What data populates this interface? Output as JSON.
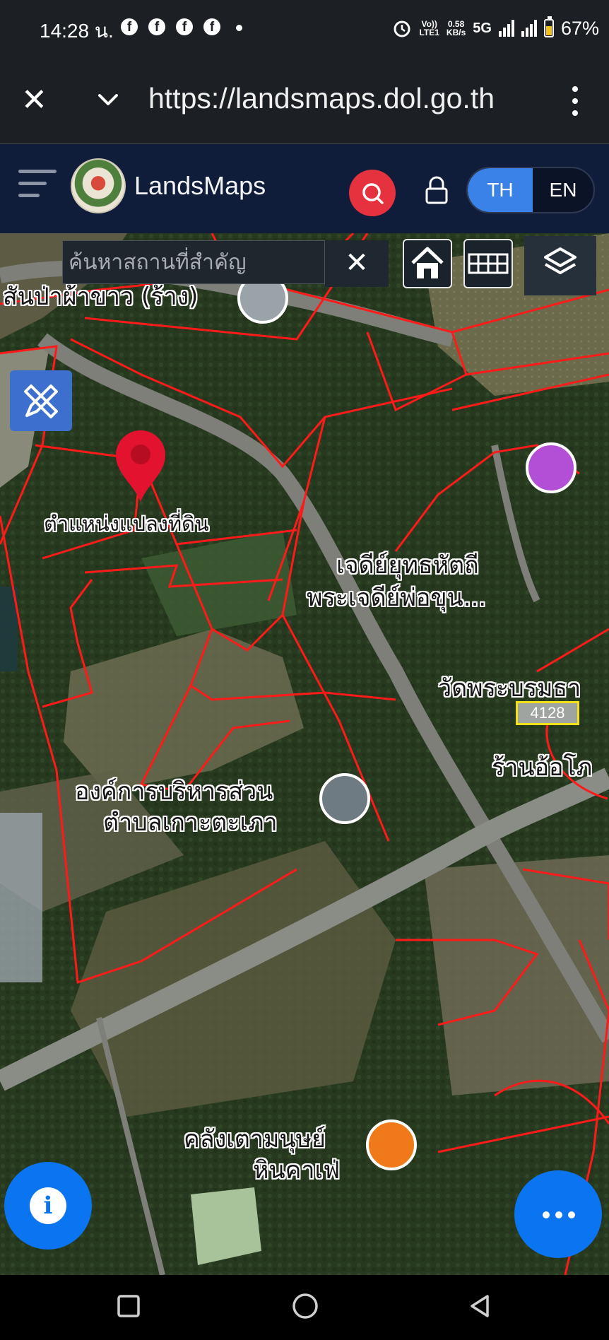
{
  "status_bar": {
    "time": "14:28 น.",
    "facebook_icons": [
      "f",
      "f",
      "f",
      "f"
    ],
    "volte_top": "Vo))",
    "volte_bottom": "LTE1",
    "speed_value": "0.58",
    "speed_unit": "KB/s",
    "network": "5G",
    "battery_percent": "67%",
    "battery_level": 0.67
  },
  "browser": {
    "url": "https://landsmaps.dol.go.th"
  },
  "header": {
    "app_title": "LandsMaps",
    "lang_th": "TH",
    "lang_en": "EN",
    "active_lang": "TH"
  },
  "search": {
    "placeholder": "ค้นหาสถานที่สำคัญ",
    "value": ""
  },
  "map_labels": {
    "place_1": "สันป่าผ้าขาว (ร้าง)",
    "parcel_marker": "ตำแหน่งแปลงที่ดิน",
    "temple_line1": "เจดีย์ยุทธหัตถี",
    "temple_line2": "พระเจดีย์พ่อขุน...",
    "road_badge": "4128",
    "temple_2": "วัดพระบรมธา",
    "shop": "ร้านอ้อโภ",
    "office_line1": "องค์การบริหารส่วน",
    "office_line2": "ตำบลเกาะตะเภา",
    "cafe_line1": "คลังเตามนุษย์",
    "cafe_line2": "หินคาเฟ่"
  },
  "colors": {
    "parcel_lines": "#ff1a1a",
    "header_bg": "#0f1c3a",
    "accent_blue": "#0b74f0",
    "search_red": "#e6323e",
    "lang_active": "#3a82e8"
  },
  "icons": {
    "info": "i"
  }
}
